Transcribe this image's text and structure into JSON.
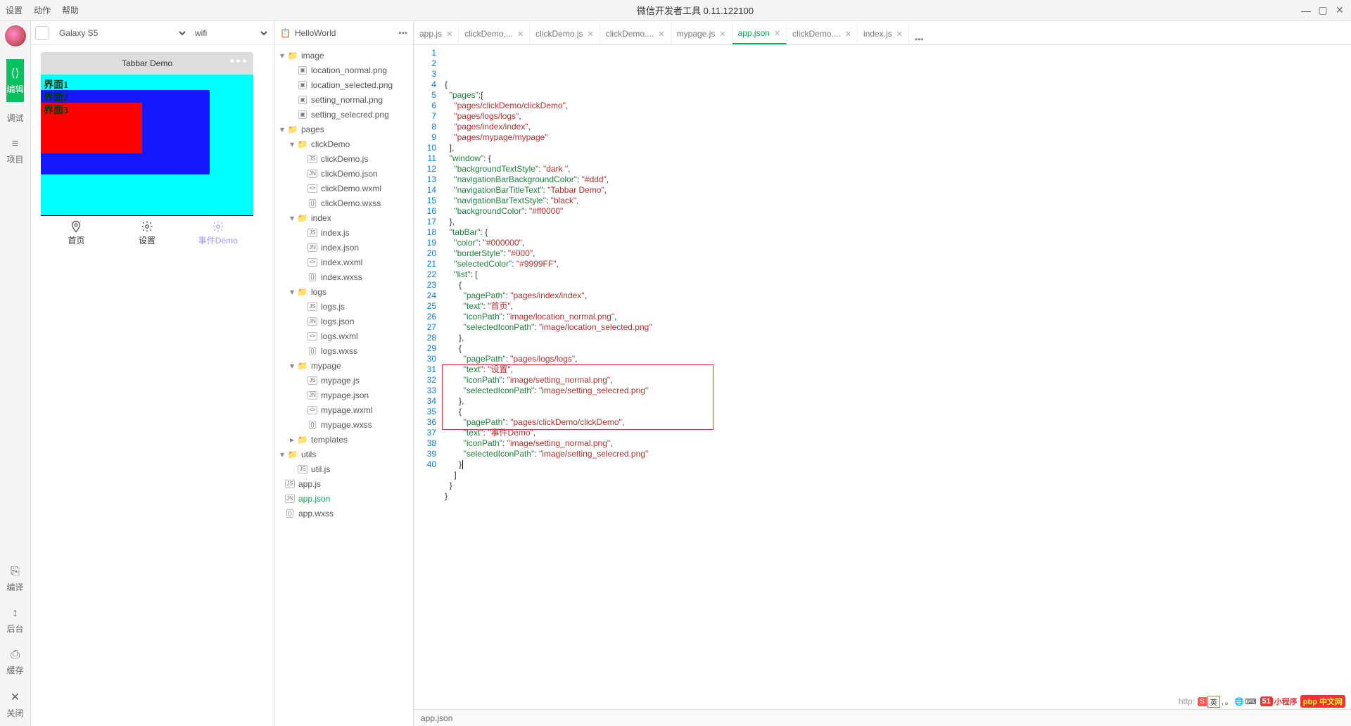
{
  "menu": {
    "settings": "设置",
    "actions": "动作",
    "help": "帮助"
  },
  "window_title": "微信开发者工具 0.11.122100",
  "win_controls": {
    "min": "—",
    "max": "▢",
    "config": "⚙",
    "close": "✕"
  },
  "rail": {
    "items": [
      {
        "icon": "⟨⟩",
        "label": "编辑",
        "id": "edit"
      },
      {
        "icon": "</>",
        "label": "调试",
        "id": "debug"
      },
      {
        "icon": "≡",
        "label": "项目",
        "id": "project"
      }
    ],
    "bottom": [
      {
        "icon": "⎘",
        "label": "编译",
        "id": "compile"
      },
      {
        "icon": "↕",
        "label": "后台",
        "id": "background"
      },
      {
        "icon": "⎙",
        "label": "缓存",
        "id": "cache"
      },
      {
        "icon": "✕",
        "label": "关闭",
        "id": "close"
      }
    ]
  },
  "device_bar": {
    "device": "Galaxy S5",
    "network": "wifi"
  },
  "phone": {
    "header_title": "Tabbar Demo",
    "body": {
      "lbl1": "界面1",
      "lbl2": "界面2",
      "lbl3": "界面3"
    },
    "tabs": [
      {
        "label": "首页",
        "id": "home"
      },
      {
        "label": "设置",
        "id": "settings"
      },
      {
        "label": "事件Demo",
        "id": "demo"
      }
    ],
    "active_tab": 2
  },
  "project": {
    "name": "HelloWorld",
    "menu": "•••"
  },
  "tree": [
    {
      "d": 0,
      "t": "folder",
      "n": "image",
      "open": true,
      "arrow": true
    },
    {
      "d": 1,
      "t": "img",
      "n": "location_normal.png"
    },
    {
      "d": 1,
      "t": "img",
      "n": "location_selected.png"
    },
    {
      "d": 1,
      "t": "img",
      "n": "setting_normal.png"
    },
    {
      "d": 1,
      "t": "img",
      "n": "setting_selecred.png"
    },
    {
      "d": 0,
      "t": "folder",
      "n": "pages",
      "open": true,
      "arrow": true
    },
    {
      "d": 1,
      "t": "folder",
      "n": "clickDemo",
      "open": true,
      "arrow": true
    },
    {
      "d": 2,
      "t": "js",
      "n": "clickDemo.js"
    },
    {
      "d": 2,
      "t": "json",
      "n": "clickDemo.json"
    },
    {
      "d": 2,
      "t": "wxml",
      "n": "clickDemo.wxml"
    },
    {
      "d": 2,
      "t": "wxss",
      "n": "clickDemo.wxss"
    },
    {
      "d": 1,
      "t": "folder",
      "n": "index",
      "open": true,
      "arrow": true
    },
    {
      "d": 2,
      "t": "js",
      "n": "index.js"
    },
    {
      "d": 2,
      "t": "json",
      "n": "index.json"
    },
    {
      "d": 2,
      "t": "wxml",
      "n": "index.wxml"
    },
    {
      "d": 2,
      "t": "wxss",
      "n": "index.wxss"
    },
    {
      "d": 1,
      "t": "folder",
      "n": "logs",
      "open": true,
      "arrow": true
    },
    {
      "d": 2,
      "t": "js",
      "n": "logs.js"
    },
    {
      "d": 2,
      "t": "json",
      "n": "logs.json"
    },
    {
      "d": 2,
      "t": "wxml",
      "n": "logs.wxml"
    },
    {
      "d": 2,
      "t": "wxss",
      "n": "logs.wxss"
    },
    {
      "d": 1,
      "t": "folder",
      "n": "mypage",
      "open": true,
      "arrow": true
    },
    {
      "d": 2,
      "t": "js",
      "n": "mypage.js"
    },
    {
      "d": 2,
      "t": "json",
      "n": "mypage.json"
    },
    {
      "d": 2,
      "t": "wxml",
      "n": "mypage.wxml"
    },
    {
      "d": 2,
      "t": "wxss",
      "n": "mypage.wxss"
    },
    {
      "d": 1,
      "t": "folder",
      "n": "templates",
      "open": false,
      "arrow": true
    },
    {
      "d": 0,
      "t": "folder",
      "n": "utils",
      "open": true,
      "arrow": true
    },
    {
      "d": 1,
      "t": "js",
      "n": "util.js"
    },
    {
      "d": 0,
      "t": "js",
      "n": "app.js",
      "root": true
    },
    {
      "d": 0,
      "t": "json",
      "n": "app.json",
      "root": true,
      "selected": true
    },
    {
      "d": 0,
      "t": "wxss",
      "n": "app.wxss",
      "root": true
    }
  ],
  "editor_tabs": [
    {
      "name": "app.js",
      "close": true
    },
    {
      "name": "clickDemo....",
      "close": true
    },
    {
      "name": "clickDemo.js",
      "close": true
    },
    {
      "name": "clickDemo....",
      "close": true
    },
    {
      "name": "mypage.js",
      "close": true
    },
    {
      "name": "app.json",
      "close": true,
      "active": true
    },
    {
      "name": "clickDemo....",
      "close": true
    },
    {
      "name": "index.js",
      "close": true
    }
  ],
  "editor_more": "•••",
  "code": {
    "lines": 40,
    "highlight": {
      "start": 31,
      "end": 37
    }
  },
  "source": {
    "pages": [
      "pages/clickDemo/clickDemo",
      "pages/logs/logs",
      "pages/index/index",
      "pages/mypage/mypage"
    ],
    "window": {
      "backgroundTextStyle": "dark ",
      "navigationBarBackgroundColor": "#ddd",
      "navigationBarTitleText": "Tabbar Demo",
      "navigationBarTextStyle": "black",
      "backgroundColor": "#ff0000"
    },
    "tabBar": {
      "color": "#000000",
      "borderStyle": "#000",
      "selectedColor": "#9999FF",
      "list": [
        {
          "pagePath": "pages/index/index",
          "text": "首页",
          "iconPath": "image/location_normal.png",
          "selectedIconPath": "image/location_selected.png"
        },
        {
          "pagePath": "pages/logs/logs",
          "text": "设置",
          "iconPath": "image/setting_normal.png",
          "selectedIconPath": "image/setting_selecred.png"
        },
        {
          "pagePath": "pages/clickDemo/clickDemo",
          "text": "事件Demo",
          "iconPath": "image/setting_normal.png",
          "selectedIconPath": "image/setting_selecred.png"
        }
      ]
    }
  },
  "status_bar": {
    "file": "app.json"
  },
  "watermark": {
    "url": "http:",
    "logo1": "51",
    "logo2": "小程序",
    "ime_s": "S",
    "ime_lang": "英",
    "ime_punc": " , 。",
    "cn": "pbp 中文网"
  }
}
